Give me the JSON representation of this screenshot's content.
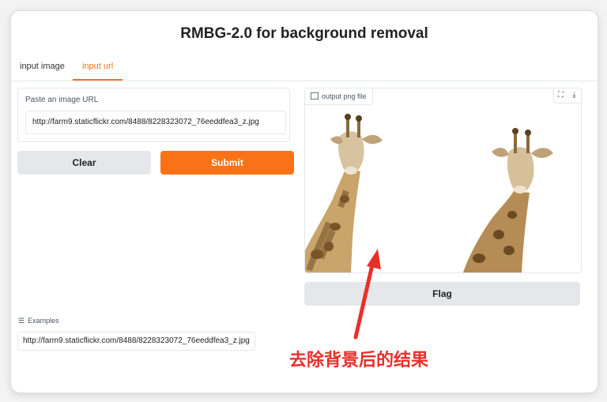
{
  "app": {
    "title": "RMBG-2.0 for background removal"
  },
  "tabs": [
    {
      "label": "input image",
      "active": false
    },
    {
      "label": "input url",
      "active": true
    }
  ],
  "url_field": {
    "label": "Paste an image URL",
    "value": "http://farm9.staticflickr.com/8488/8228323072_76eeddfea3_z.jpg"
  },
  "buttons": {
    "clear": "Clear",
    "submit": "Submit",
    "flag": "Flag"
  },
  "examples": {
    "label": "Examples",
    "items": [
      "http://farm9.staticflickr.com/8488/8228323072_76eeddfea3_z.jpg"
    ]
  },
  "output": {
    "label": "output png file",
    "tools": [
      "fullscreen-icon",
      "download-icon"
    ]
  },
  "annotation": {
    "text": "去除背景后的结果"
  },
  "colors": {
    "accent": "#f97316",
    "annotation": "#e8302a"
  }
}
